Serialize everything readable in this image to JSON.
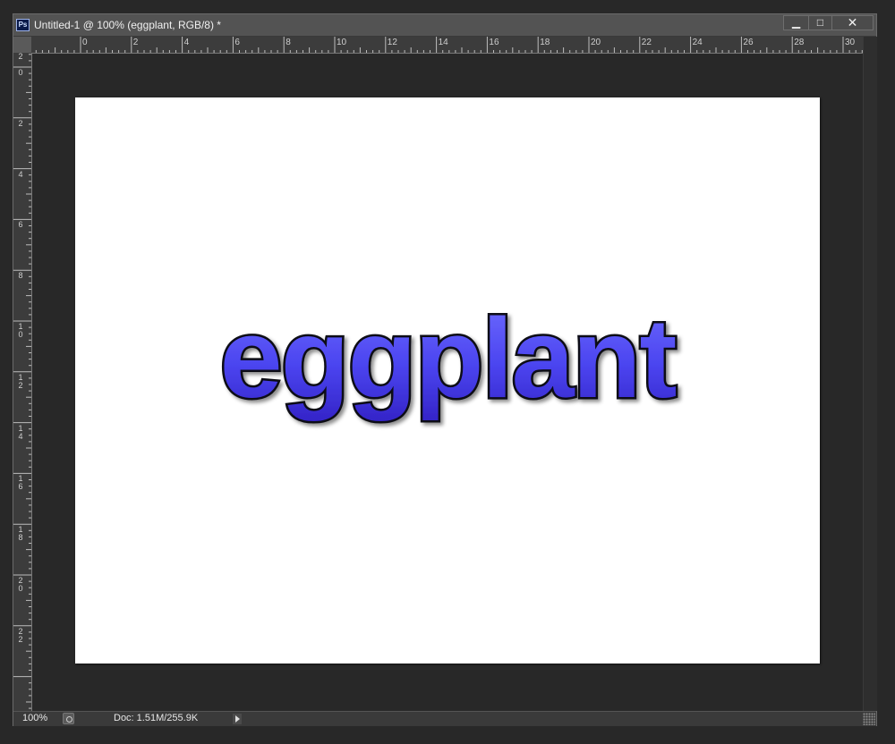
{
  "window": {
    "title": "Untitled-1 @ 100% (eggplant, RGB/8) *",
    "app_icon_label": "Ps",
    "buttons": {
      "minimize": "▁",
      "maximize": "□",
      "close": "✕"
    }
  },
  "rulers": {
    "horizontal": [
      "0",
      "2",
      "4",
      "6",
      "8",
      "10",
      "12",
      "14",
      "16",
      "18",
      "20",
      "22",
      "24",
      "26",
      "28",
      "30"
    ],
    "vertical": [
      "2",
      "0",
      "2",
      "4",
      "6",
      "8",
      "10",
      "12",
      "14",
      "16",
      "18",
      "20",
      "22"
    ]
  },
  "canvas": {
    "text": "eggplant",
    "background": "#ffffff",
    "text_colors": {
      "top": "#6f6cff",
      "mid": "#4b45f0",
      "bottom": "#3424c8",
      "stroke": "#0a0a12"
    }
  },
  "status": {
    "zoom": "100%",
    "doc_info": "Doc: 1.51M/255.9K"
  }
}
